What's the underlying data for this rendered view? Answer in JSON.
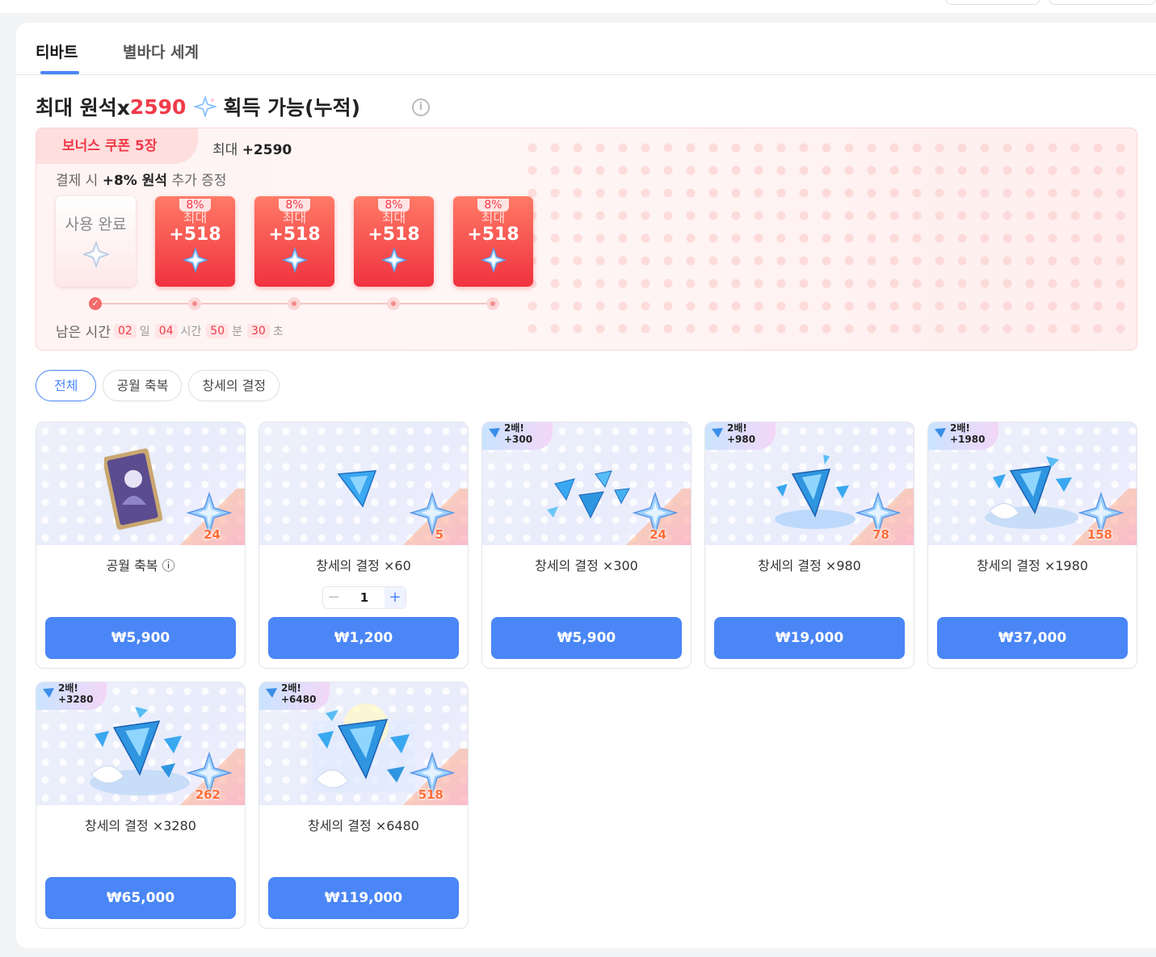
{
  "tabs": [
    {
      "label": "티바트",
      "active": true
    },
    {
      "label": "별바다 세계",
      "active": false
    }
  ],
  "headline": {
    "prefix": "최대 원석x",
    "amount": "2590",
    "suffix": "획득 가능(누적)"
  },
  "bonus": {
    "coupon_label": "보너스 쿠폰 5장",
    "max_prefix": "최대",
    "max_amount": "+2590",
    "note_prefix": "결제 시",
    "note_bold": "+8% 원석",
    "note_suffix": "추가 증정",
    "used_label": "사용 완료",
    "cards": [
      {
        "state": "used"
      },
      {
        "state": "active",
        "pct": "8%",
        "max": "최대",
        "amount": "+518"
      },
      {
        "state": "active",
        "pct": "8%",
        "max": "최대",
        "amount": "+518"
      },
      {
        "state": "active",
        "pct": "8%",
        "max": "최대",
        "amount": "+518"
      },
      {
        "state": "active",
        "pct": "8%",
        "max": "최대",
        "amount": "+518"
      }
    ],
    "timer": {
      "label": "남은 시간",
      "days": "02",
      "days_unit": "일",
      "hours": "04",
      "hours_unit": "시간",
      "minutes": "50",
      "minutes_unit": "분",
      "seconds": "30",
      "seconds_unit": "초"
    }
  },
  "filters": [
    {
      "label": "전체",
      "active": true
    },
    {
      "label": "공월 축복",
      "active": false
    },
    {
      "label": "창세의 결정",
      "active": false
    }
  ],
  "products": [
    {
      "name": "공월 축복 ⓘ",
      "qty": "24",
      "price": "₩5,900",
      "badge": null
    },
    {
      "name": "창세의 결정 ×60",
      "qty": "5",
      "price": "₩1,200",
      "badge": null,
      "stepper": "1"
    },
    {
      "name": "창세의 결정 ×300",
      "qty": "24",
      "price": "₩5,900",
      "badge": {
        "line1": "2배!",
        "line2": "+300"
      }
    },
    {
      "name": "창세의 결정 ×980",
      "qty": "78",
      "price": "₩19,000",
      "badge": {
        "line1": "2배!",
        "line2": "+980"
      }
    },
    {
      "name": "창세의 결정 ×1980",
      "qty": "158",
      "price": "₩37,000",
      "badge": {
        "line1": "2배!",
        "line2": "+1980"
      }
    },
    {
      "name": "창세의 결정 ×3280",
      "qty": "262",
      "price": "₩65,000",
      "badge": {
        "line1": "2배!",
        "line2": "+3280"
      }
    },
    {
      "name": "창세의 결정 ×6480",
      "qty": "518",
      "price": "₩119,000",
      "badge": {
        "line1": "2배!",
        "line2": "+6480"
      }
    }
  ],
  "colors": {
    "accent": "#4a86f5",
    "highlight": "#ef3b4a",
    "coupon": "#f0323f"
  }
}
